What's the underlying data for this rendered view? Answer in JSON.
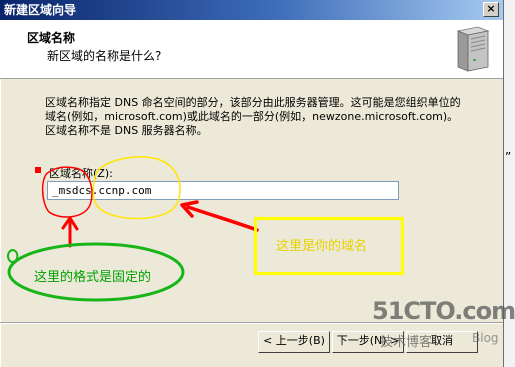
{
  "window": {
    "title": "新建区域向导",
    "close_glyph": "×"
  },
  "header": {
    "title": "区域名称",
    "subtitle": "新区域的名称是什么?",
    "icon": "server-icon"
  },
  "body": {
    "description": "区域名称指定 DNS 命名空间的部分，该部分由此服务器管理。这可能是您组织单位的域名(例如，microsoft.com)或此域名的一部分(例如，newzone.microsoft.com)。区域名称不是 DNS 服务器名称。",
    "field_label": "区域名称(Z):",
    "zone_name_value": "_msdcs.ccnp.com"
  },
  "buttons": {
    "back": "< 上一步(B)",
    "next": "下一步(N) >",
    "cancel": "取消"
  },
  "annotations": {
    "yellow_note": "这里是你的域名",
    "green_note": "这里的格式是固定的",
    "colors": {
      "red": "#ff0000",
      "yellow": "#ffff00",
      "green": "#00b000"
    }
  },
  "watermark": {
    "site": "51CTO.com",
    "subtitle": "技术博客",
    "blog": "Blog"
  },
  "background": {
    "stray_text": "”"
  }
}
